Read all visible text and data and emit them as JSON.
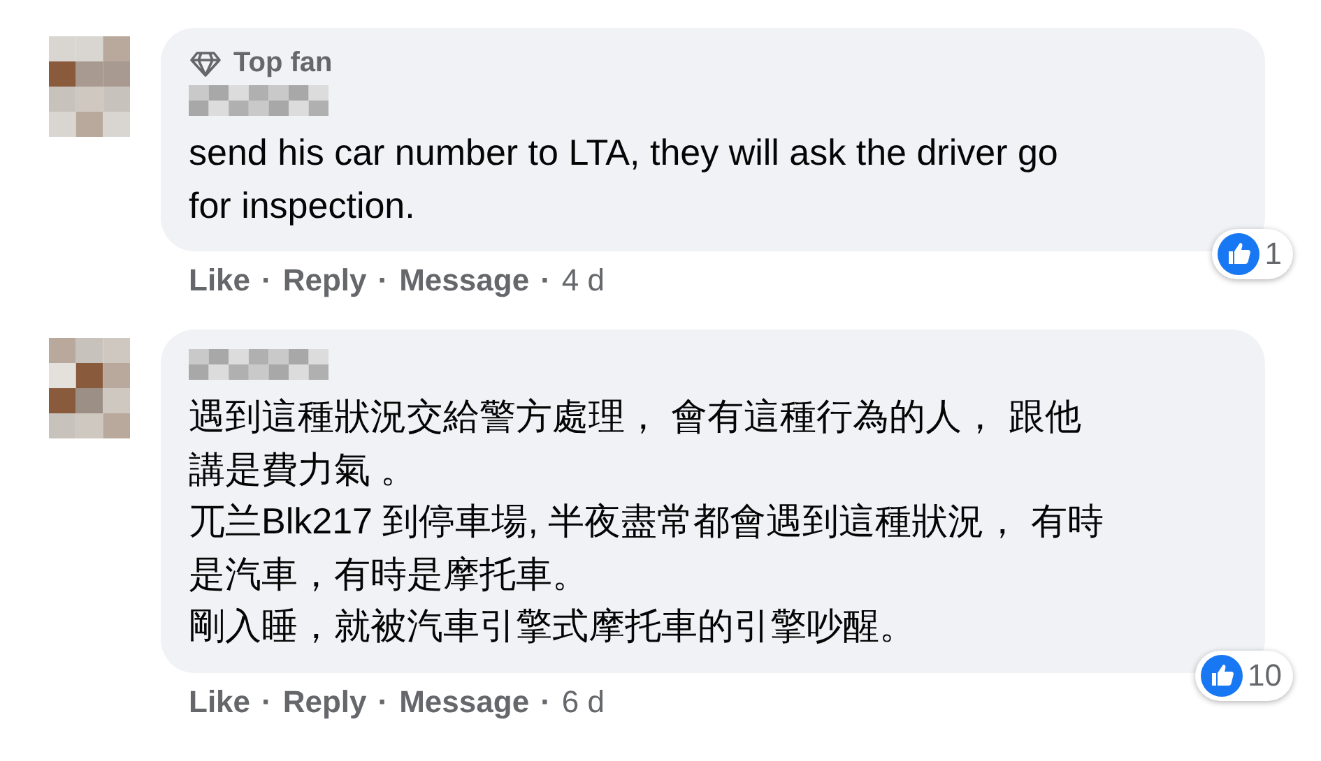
{
  "separator": "·",
  "comments": [
    {
      "badge": "Top fan",
      "text_lines": [
        "send his car number to LTA, they will ask the driver go",
        "for inspection."
      ],
      "actions": [
        "Like",
        "Reply",
        "Message"
      ],
      "time": "4 d",
      "reaction_count": "1"
    },
    {
      "text_lines": [
        "遇到這種狀況交給警方處理， 會有這種行為的人， 跟他",
        "講是費力氣 。",
        "兀兰Blk217 到停車場, 半夜盡常都會遇到這種狀況， 有時",
        "是汽車，有時是摩托車。",
        "剛入睡，就被汽車引擎式摩托車的引擎吵醒。"
      ],
      "actions": [
        "Like",
        "Reply",
        "Message"
      ],
      "time": "6 d",
      "reaction_count": "10"
    }
  ]
}
